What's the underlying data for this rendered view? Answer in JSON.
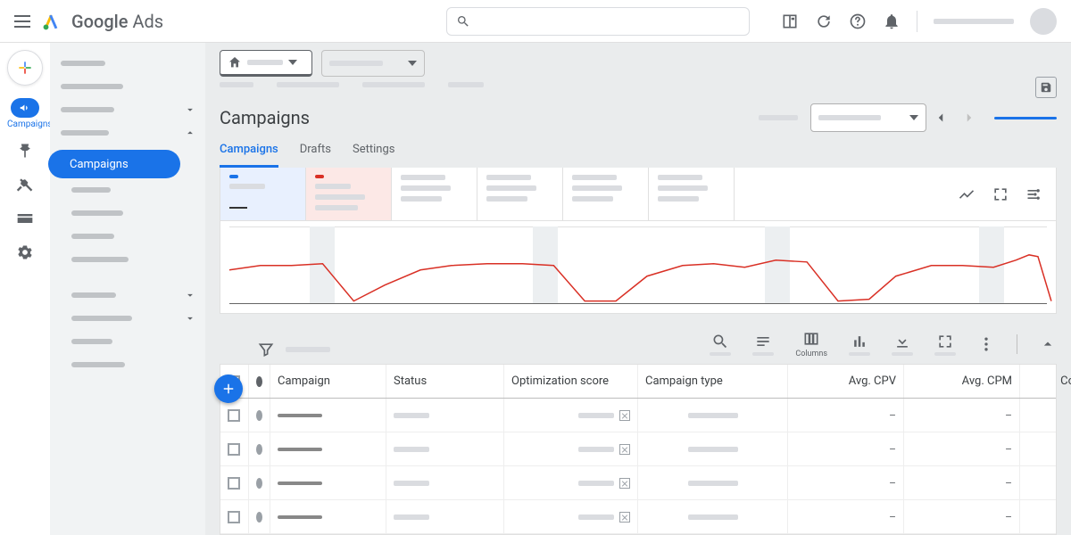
{
  "header": {
    "brand_google": "Google",
    "brand_ads": "Ads"
  },
  "rail": {
    "active_label": "Campaigns"
  },
  "sidebar": {
    "active_label": "Campaigns"
  },
  "page": {
    "title": "Campaigns"
  },
  "tabs": {
    "t1": "Campaigns",
    "t2": "Drafts",
    "t3": "Settings"
  },
  "toolbar": {
    "columns_label": "Columns"
  },
  "table": {
    "headers": {
      "campaign": "Campaign",
      "status": "Status",
      "opt": "Optimization score",
      "type": "Campaign type",
      "cpv": "Avg. CPV",
      "cpm": "Avg. CPM",
      "cost": "Cost"
    },
    "rows": [
      {
        "cpv": "–",
        "cpm": "–",
        "cost": "–"
      },
      {
        "cpv": "–",
        "cpm": "–",
        "cost": "–"
      },
      {
        "cpv": "–",
        "cpm": "–",
        "cost": "–"
      },
      {
        "cpv": "–",
        "cpm": "–",
        "cost": "–"
      }
    ]
  },
  "chart_data": {
    "type": "line",
    "series": [
      {
        "name": "metric-red",
        "values": [
          58,
          60,
          60,
          62,
          10,
          28,
          48,
          55,
          60,
          60,
          58,
          12,
          10,
          42,
          56,
          58,
          54,
          64,
          62,
          10,
          12,
          44,
          58,
          58,
          56,
          66,
          72,
          70,
          10
        ]
      }
    ],
    "xlabel": "",
    "ylabel": "",
    "ylim": [
      0,
      100
    ]
  }
}
